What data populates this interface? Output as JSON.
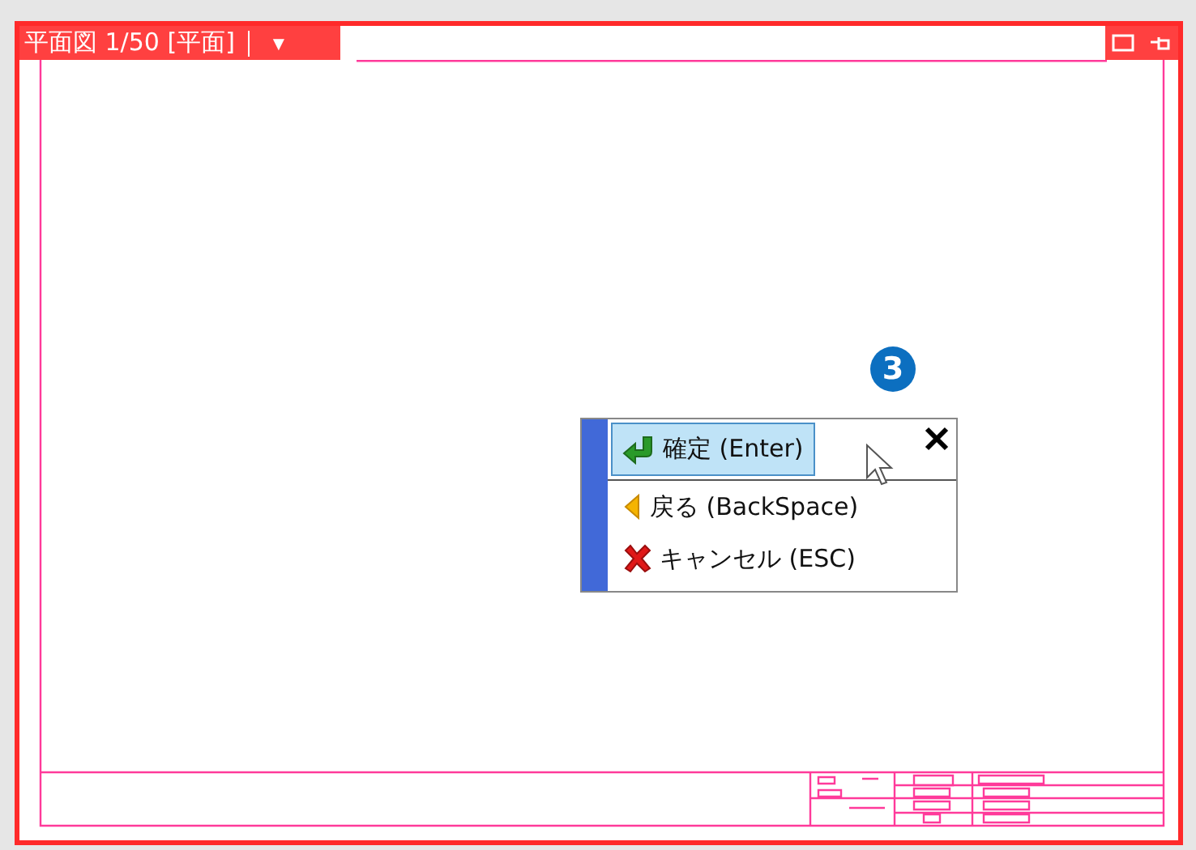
{
  "view_tab": {
    "title": "平面図 1/50 [平面]",
    "dropdown": "▼"
  },
  "popup_menu": {
    "step_badge": "3",
    "items": [
      {
        "kind": "confirm",
        "label": "確定 (Enter)",
        "selected": true
      },
      {
        "kind": "back",
        "label": "戻る (BackSpace)",
        "selected": false
      },
      {
        "kind": "cancel",
        "label": "キャンセル (ESC)",
        "selected": false
      }
    ]
  }
}
